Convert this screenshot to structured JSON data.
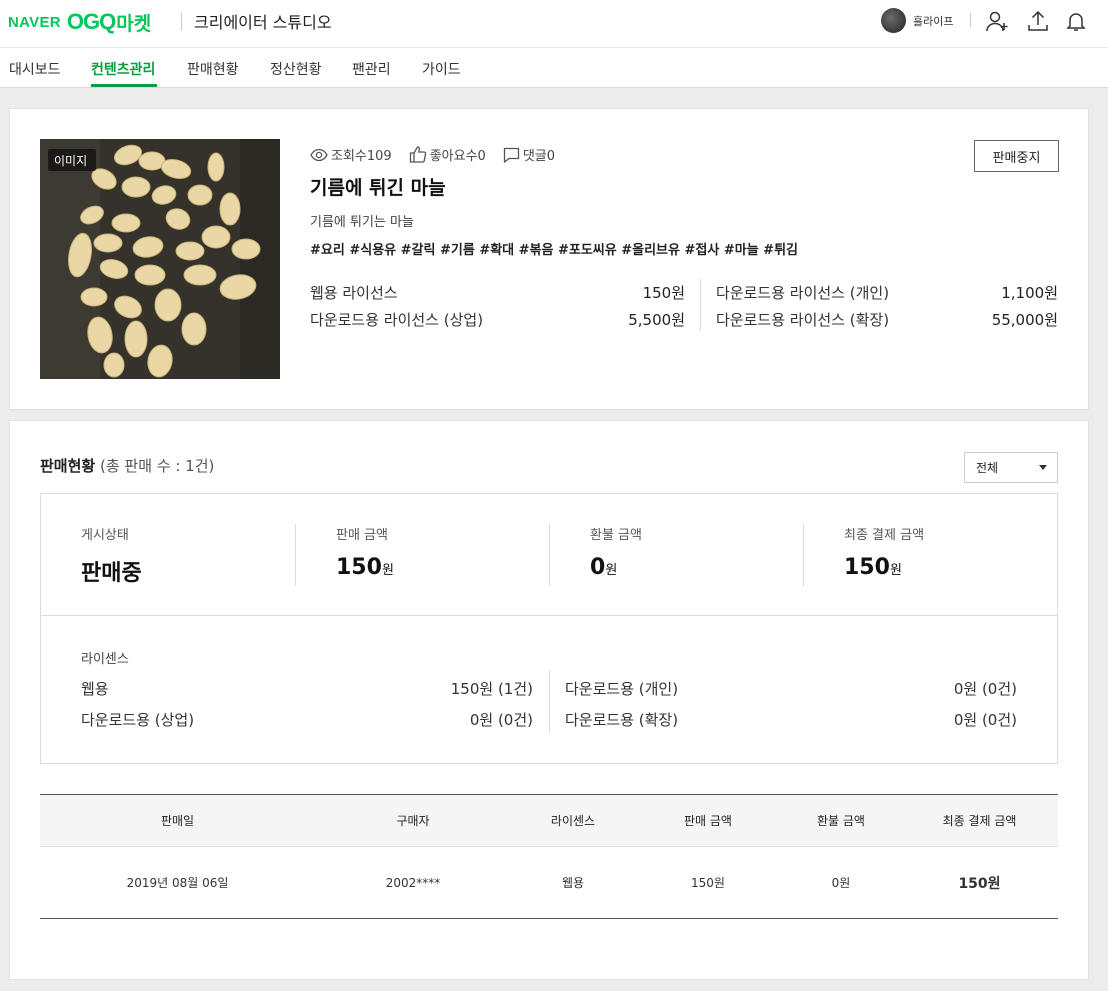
{
  "header": {
    "logo_naver": "NAVER",
    "logo_ogq": "OGQ",
    "logo_market": "마켓",
    "studio_title": "크리에이터 스튜디오",
    "user_name": "흘라이프"
  },
  "nav": {
    "items": [
      {
        "label": "대시보드"
      },
      {
        "label": "컨텐츠관리"
      },
      {
        "label": "판매현황"
      },
      {
        "label": "정산현황"
      },
      {
        "label": "팬관리"
      },
      {
        "label": "가이드"
      }
    ],
    "active": "컨텐츠관리"
  },
  "content": {
    "thumb_label": "이미지",
    "views": "조회수109",
    "likes": "좋아요수0",
    "comments": "댓글0",
    "title": "기름에 튀긴 마늘",
    "description": "기름에 튀기는 마늘",
    "tags": "#요리 #식용유 #갈릭 #기름 #확대 #볶음 #포도씨유 #올리브유 #접사 #마늘 #튀김",
    "stop_button": "판매중지",
    "licenses": [
      {
        "label": "웹용 라이선스",
        "price": "150원"
      },
      {
        "label": "다운로드용 라이선스 (개인)",
        "price": "1,100원"
      },
      {
        "label": "다운로드용 라이선스 (상업)",
        "price": "5,500원"
      },
      {
        "label": "다운로드용 라이선스 (확장)",
        "price": "55,000원"
      }
    ]
  },
  "sales": {
    "heading": "판매현황",
    "heading_sub": "(총 판매 수 : 1건)",
    "filter": "전체",
    "summary": [
      {
        "label": "게시상태",
        "value": "판매중",
        "unit": ""
      },
      {
        "label": "판매 금액",
        "value": "150",
        "unit": "원"
      },
      {
        "label": "환불 금액",
        "value": "0",
        "unit": "원"
      },
      {
        "label": "최종 결제 금액",
        "value": "150",
        "unit": "원"
      }
    ],
    "license_title": "라이센스",
    "license_breakdown": [
      {
        "label": "웹용",
        "value": "150원 (1건)"
      },
      {
        "label": "다운로드용 (개인)",
        "value": "0원 (0건)"
      },
      {
        "label": "다운로드용 (상업)",
        "value": "0원 (0건)"
      },
      {
        "label": "다운로드용 (확장)",
        "value": "0원 (0건)"
      }
    ],
    "table": {
      "columns": [
        "판매일",
        "구매자",
        "라이센스",
        "판매 금액",
        "환불 금액",
        "최종 결제 금액"
      ],
      "rows": [
        {
          "date": "2019년 08월 06일",
          "buyer": "2002****",
          "license": "웹용",
          "sale": "150원",
          "refund": "0원",
          "final": "150원"
        }
      ]
    }
  },
  "colors": {
    "brand": "#03c75a",
    "active_nav": "#0a9e3f"
  }
}
